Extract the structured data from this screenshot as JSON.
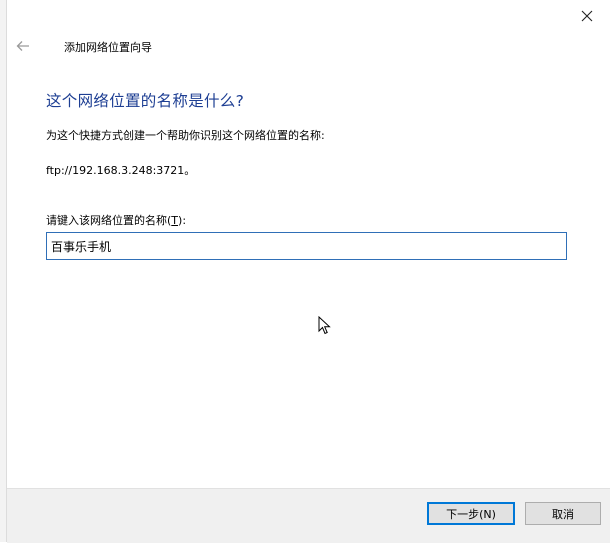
{
  "window": {
    "close_icon": "close-icon",
    "back_icon": "back-arrow-icon",
    "wizard_title": "添加网络位置向导"
  },
  "page": {
    "heading": "这个网络位置的名称是什么?",
    "instruction": "为这个快捷方式创建一个帮助你识别这个网络位置的名称:",
    "ftp_path": "ftp://192.168.3.248:3721。",
    "name_label_prefix": "请键入该网络位置的名称(",
    "name_label_key": "T",
    "name_label_suffix": "):",
    "name_value": "百事乐手机"
  },
  "footer": {
    "next_label": "下一步(N)",
    "cancel_label": "取消"
  },
  "colors": {
    "heading": "#1d3e93",
    "input_border": "#2f6fb7",
    "primary_button_border": "#0078d7"
  }
}
